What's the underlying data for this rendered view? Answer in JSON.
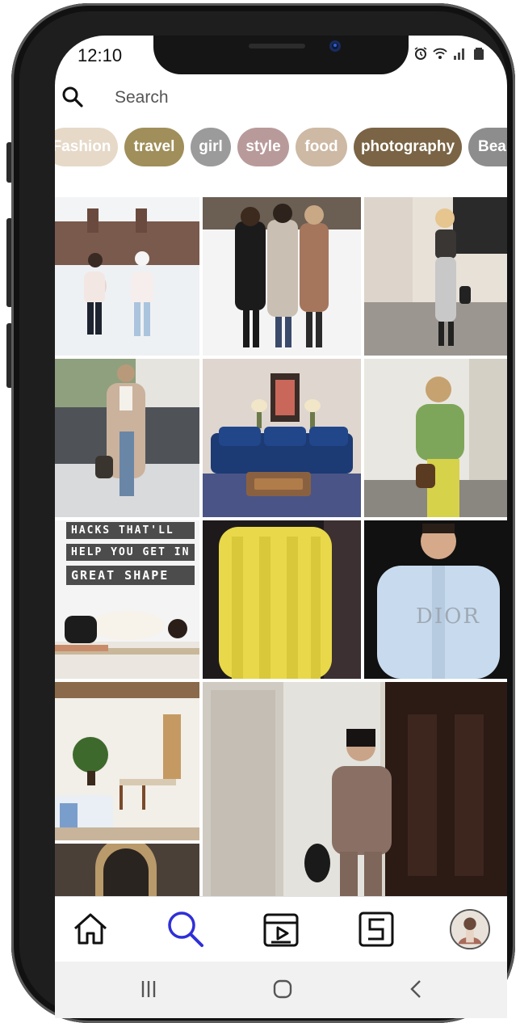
{
  "status_bar": {
    "time": "12:10",
    "icons": [
      "alarm-icon",
      "wifi-icon",
      "signal-icon",
      "battery-icon"
    ]
  },
  "search": {
    "placeholder": "Search",
    "icon": "search-icon"
  },
  "tags": [
    {
      "label": "Fashion",
      "color": "#e6d9c8"
    },
    {
      "label": "travel",
      "color": "#a08f5a"
    },
    {
      "label": "girl",
      "color": "#9b9b9b"
    },
    {
      "label": "style",
      "color": "#b99a9a"
    },
    {
      "label": "food",
      "color": "#cdb9a4"
    },
    {
      "label": "photography",
      "color": "#7a6445"
    },
    {
      "label": "Beau",
      "color": "#8d8d8d"
    }
  ],
  "grid": {
    "tiles": [
      {
        "subject": "couple-ice-skating"
      },
      {
        "subject": "three-women-winter-coats"
      },
      {
        "subject": "woman-knit-dress-stairs"
      },
      {
        "subject": "woman-teddy-coat-street"
      },
      {
        "subject": "living-room-blue-sofa"
      },
      {
        "subject": "woman-green-sweater"
      },
      {
        "subject": "yoga-fitness-post",
        "caption_lines": [
          "HACKS THAT'LL",
          "HELP YOU GET IN",
          "GREAT SHAPE"
        ]
      },
      {
        "subject": "yellow-fur-coat"
      },
      {
        "subject": "man-blue-shirt",
        "caption": "DIOR"
      },
      {
        "subject": "kitchen-interior"
      },
      {
        "subject": "woman-pajama-set"
      },
      {
        "subject": "arched-doorway"
      }
    ]
  },
  "bottom_nav": {
    "items": [
      {
        "icon": "home-icon"
      },
      {
        "icon": "search-icon",
        "active": true,
        "active_color": "#2f2fd8"
      },
      {
        "icon": "reels-icon"
      },
      {
        "icon": "shop-icon"
      },
      {
        "icon": "avatar"
      }
    ]
  },
  "system_nav": {
    "items": [
      "recent-apps-icon",
      "home-button-icon",
      "back-icon"
    ]
  }
}
